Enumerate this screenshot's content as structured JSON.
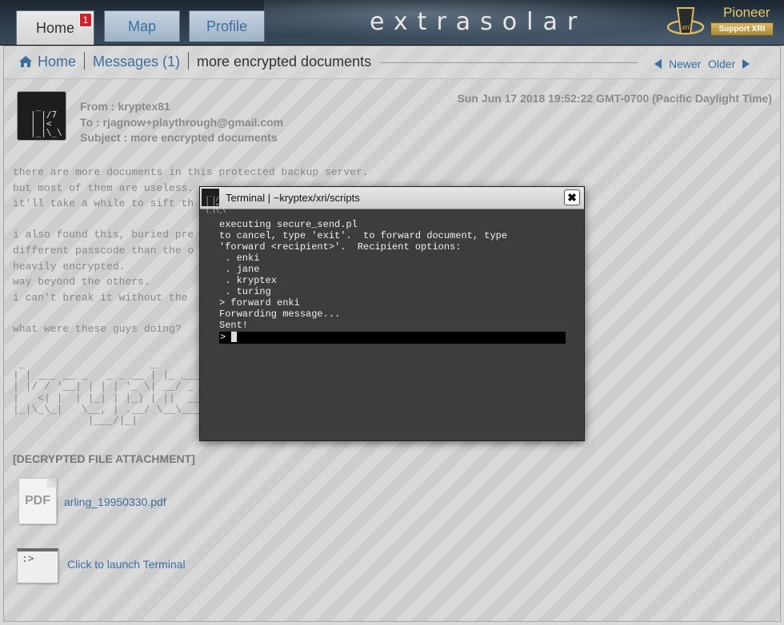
{
  "tabs": [
    {
      "label": "Home",
      "badge": "1"
    },
    {
      "label": "Map"
    },
    {
      "label": "Profile"
    }
  ],
  "brand": {
    "title": "extrasolar",
    "logo_text": "xri",
    "tier": "Pioneer",
    "support_label": "Support XRI",
    "accent": "#e9c86c"
  },
  "breadcrumb": {
    "home": "Home",
    "messages": "Messages (1)",
    "current": "more encrypted documents"
  },
  "pager": {
    "newer": "Newer",
    "older": "Older"
  },
  "message": {
    "avatar_art": " _\n| |/7\n| |<\n|_|\\_\\",
    "from": "From : kryptex81",
    "to": "To : rjagnow+playthrough@gmail.com",
    "subject": "Subject : more encrypted documents",
    "date": "Sun Jun 17 2018 19:52:22 GMT-0700 (Pacific Daylight Time)",
    "body": "there are more documents in this protected backup server.\nbut most of them are useless.\nit'll take a while to sift th\n\ni also found this, buried pre\ndifferent passcode than the o\nheavily encrypted.\nway beyond the others.\ni can't break it without the \n\nwhat were these guys doing?",
    "ascii_art": " _                    _\n| | ___ __ _   _ _ __ | |_ _____\n| |/ / '__| | | | '_ \\| __/ _ \\ \\/\n|   <| |  | |_| | |_) | ||  __/>\n|_|\\_\\_|   \\__, | .__/ \\__\\___/_/\\\n            |___/|_|",
    "attachment_heading": "[DECRYPTED FILE ATTACHMENT]",
    "attachment_icon_label": "PDF",
    "attachment_name": "arling_19950330.pdf",
    "terminal_icon_label": ":>",
    "terminal_link": "Click to launch Terminal"
  },
  "terminal": {
    "title": "Terminal | ~kryptex/xri/scripts",
    "close_label": "✖",
    "output": "executing secure_send.pl\nto cancel, type 'exit'.  to forward document, type\n'forward <recipient>'.  Recipient options:\n . enki\n . jane\n . kryptex\n . turing\n> forward enki\nForwarding message...\nSent!",
    "prompt": ">"
  }
}
